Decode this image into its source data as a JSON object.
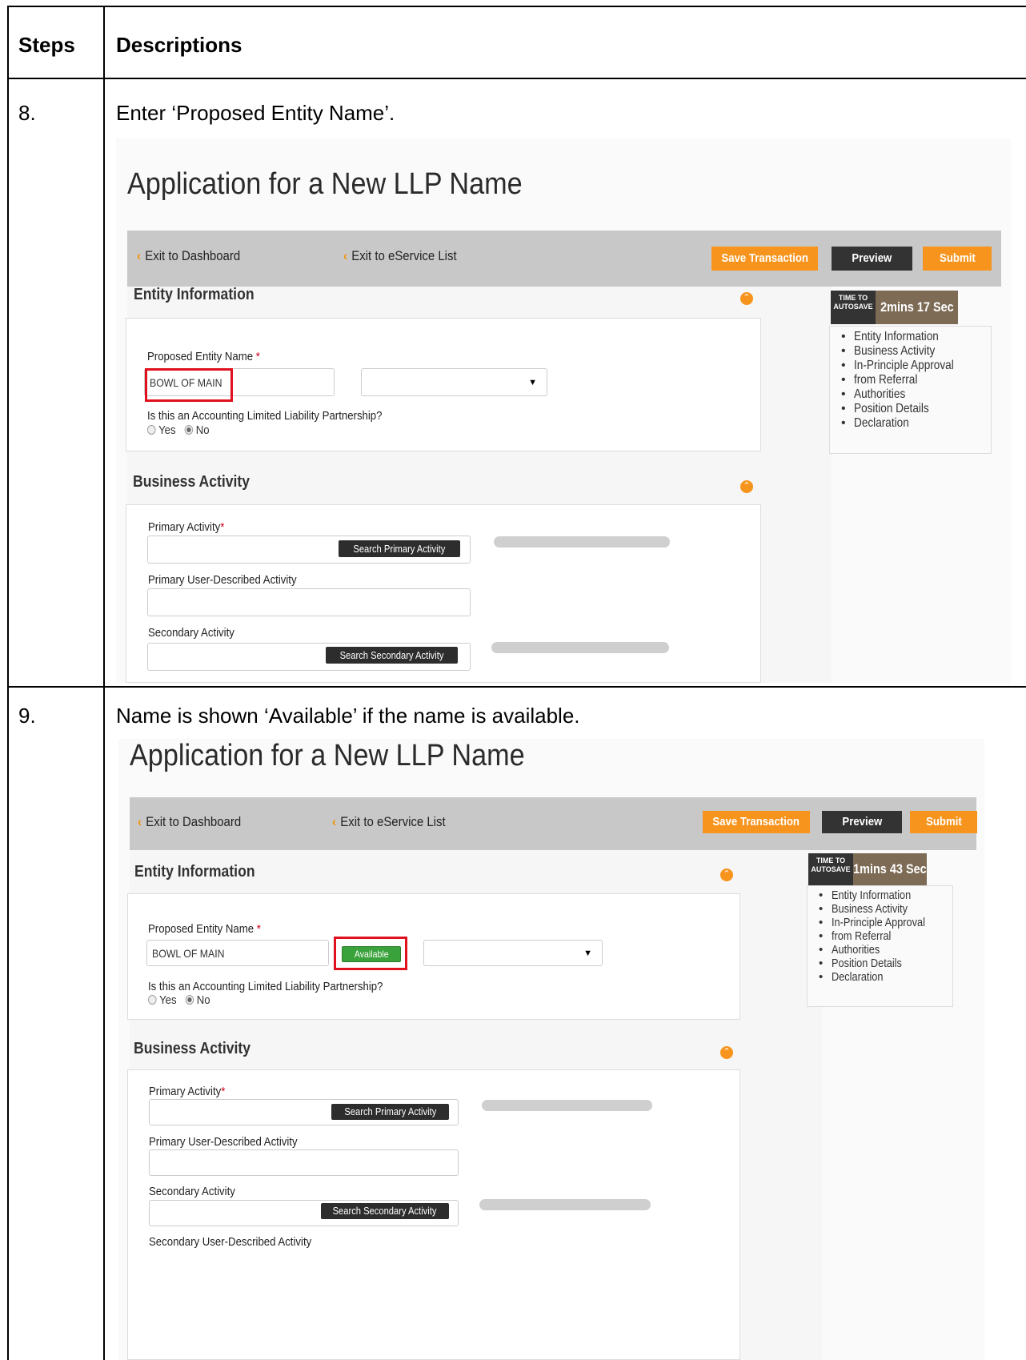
{
  "table": {
    "header_steps": "Steps",
    "header_descriptions": "Descriptions"
  },
  "rows": [
    {
      "step": "8.",
      "description": "Enter ‘Proposed Entity Name’.",
      "shot": {
        "title": "Application for a New LLP Name",
        "exit_dashboard": "Exit to Dashboard",
        "exit_eservice": "Exit to eService List",
        "save": "Save Transaction",
        "preview": "Preview",
        "submit": "Submit",
        "timer_label": "TIME TO AUTOSAVE",
        "timer_value": "2mins 17 Sec",
        "nav": [
          "Entity Information",
          "Business Activity",
          "In-Principle Approval",
          "from Referral",
          "Authorities",
          "Position Details",
          "Declaration"
        ],
        "entity_title": "Entity Information",
        "proposed_label": "Proposed Entity Name",
        "proposed_value": "BOWL OF MAIN",
        "accounting_q": "Is this an Accounting Limited Liability Partnership?",
        "yes": "Yes",
        "no": "No",
        "business_title": "Business Activity",
        "primary_label": "Primary Activity",
        "search_primary": "Search Primary Activity",
        "primary_user_label": "Primary User-Described Activity",
        "secondary_label": "Secondary Activity",
        "search_secondary": "Search Secondary Activity"
      }
    },
    {
      "step": "9.",
      "description": "Name is shown ‘Available’ if the name is available.",
      "shot": {
        "title": "Application for a New LLP Name",
        "exit_dashboard": "Exit to Dashboard",
        "exit_eservice": "Exit to eService List",
        "save": "Save Transaction",
        "preview": "Preview",
        "submit": "Submit",
        "timer_label": "TIME TO AUTOSAVE",
        "timer_value": "1mins 43 Sec",
        "nav": [
          "Entity Information",
          "Business Activity",
          "In-Principle Approval",
          "from Referral",
          "Authorities",
          "Position Details",
          "Declaration"
        ],
        "entity_title": "Entity Information",
        "proposed_label": "Proposed Entity Name",
        "proposed_value": "BOWL OF MAIN",
        "available": "Available",
        "accounting_q": "Is this an Accounting Limited Liability Partnership?",
        "yes": "Yes",
        "no": "No",
        "business_title": "Business Activity",
        "primary_label": "Primary Activity",
        "search_primary": "Search Primary Activity",
        "primary_user_label": "Primary User-Described Activity",
        "secondary_label": "Secondary Activity",
        "search_secondary": "Search Secondary Activity",
        "secondary_user_label": "Secondary User-Described Activity"
      }
    }
  ],
  "colors": {
    "accent_orange": "#f7941d",
    "dark_button": "#333333",
    "timer_brown": "#7d6b55",
    "available_green": "#3aa23a",
    "highlight_red": "#e0101c"
  }
}
